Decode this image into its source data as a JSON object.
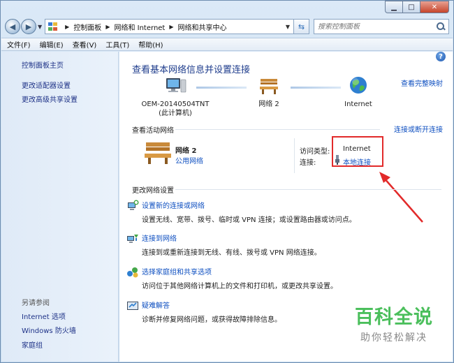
{
  "address": {
    "crumbs": [
      "控制面板",
      "网络和 Internet",
      "网络和共享中心"
    ],
    "search_placeholder": "搜索控制面板"
  },
  "menu": [
    "文件(F)",
    "编辑(E)",
    "查看(V)",
    "工具(T)",
    "帮助(H)"
  ],
  "sidebar": {
    "items": [
      "控制面板主页",
      "更改适配器设置",
      "更改高级共享设置"
    ],
    "see_also_title": "另请参阅",
    "see_also": [
      "Internet 选项",
      "Windows 防火墙",
      "家庭组"
    ]
  },
  "main": {
    "title": "查看基本网络信息并设置连接",
    "full_map_link": "查看完整映射",
    "nodes": {
      "computer_name": "OEM-20140504TNT",
      "computer_sub": "(此计算机)",
      "network": "网络  2",
      "internet": "Internet"
    },
    "active_section_title": "查看活动网络",
    "connect_disconnect_link": "连接或断开连接",
    "active_network": {
      "name": "网络  2",
      "type_link": "公用网络",
      "access_label": "访问类型:",
      "access_value": "Internet",
      "connection_label": "连接:",
      "connection_link": "本地连接"
    },
    "change_section_title": "更改网络设置",
    "tasks": [
      {
        "title": "设置新的连接或网络",
        "desc": "设置无线、宽带、拨号、临时或 VPN 连接；或设置路由器或访问点。"
      },
      {
        "title": "连接到网络",
        "desc": "连接到或重新连接到无线、有线、拨号或 VPN 网络连接。"
      },
      {
        "title": "选择家庭组和共享选项",
        "desc": "访问位于其他网络计算机上的文件和打印机，或更改共享设置。"
      },
      {
        "title": "疑难解答",
        "desc": "诊断并修复网络问题，或获得故障排除信息。"
      }
    ]
  },
  "watermark": {
    "main": "百科全说",
    "sub": "助你轻松解决"
  },
  "colors": {
    "link": "#0e4fc0",
    "heading": "#1e3c8c",
    "highlight": "#e22a2a",
    "watermark": "#4bbf5c"
  }
}
